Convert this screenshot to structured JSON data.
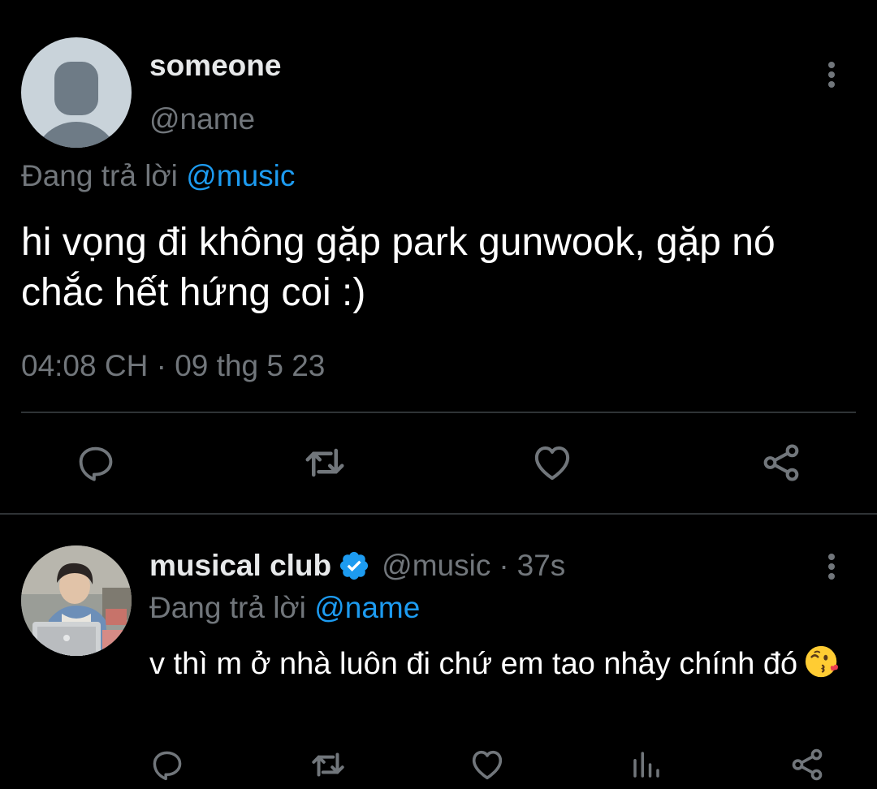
{
  "main_tweet": {
    "display_name": "someone",
    "handle": "@name",
    "replying_prefix": "Đang trả lời",
    "replying_to": "@music",
    "text": "hi vọng đi không gặp park gunwook, gặp nó chắc hết hứng coi :)",
    "timestamp": "04:08 CH · 09 thg 5 23",
    "actions": [
      {
        "name": "reply",
        "icon": "comment-icon"
      },
      {
        "name": "retweet",
        "icon": "retweet-icon"
      },
      {
        "name": "like",
        "icon": "heart-icon"
      },
      {
        "name": "share",
        "icon": "share-icon"
      }
    ]
  },
  "reply_tweet": {
    "display_name": "musical club",
    "verified": true,
    "handle": "@music",
    "separator": "·",
    "time_ago": "37s",
    "replying_prefix": "Đang trả lời",
    "replying_to": "@name",
    "text": "v thì m ở nhà luôn đi chứ em tao nhảy chính đó",
    "emoji": "face-blowing-a-kiss",
    "actions": [
      {
        "name": "reply",
        "icon": "comment-icon"
      },
      {
        "name": "retweet",
        "icon": "retweet-icon"
      },
      {
        "name": "like",
        "icon": "heart-icon"
      },
      {
        "name": "analytics",
        "icon": "bar-chart-icon"
      },
      {
        "name": "share",
        "icon": "share-icon"
      }
    ]
  },
  "colors": {
    "background": "#000000",
    "text_primary": "#e7e9ea",
    "text_secondary": "#71767b",
    "accent": "#1d9bf0",
    "divider": "#2f3336",
    "icon": "#71767b"
  }
}
